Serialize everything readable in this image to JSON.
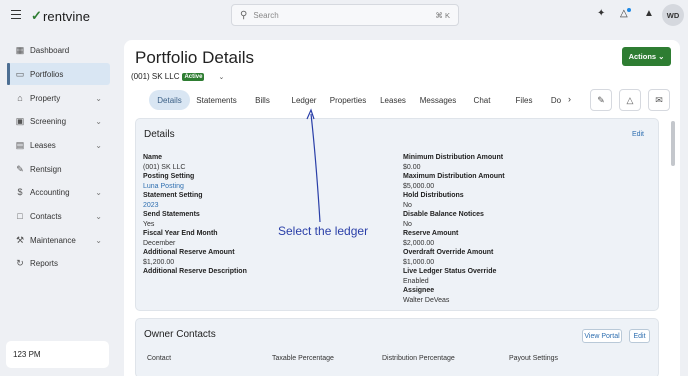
{
  "header": {
    "brand": "rentvine",
    "brand_mark": "✓",
    "search_placeholder": "Search",
    "search_shortcut": "⌘ K",
    "avatar_initials": "WD"
  },
  "sidebar": {
    "items": [
      {
        "label": "Dashboard",
        "icon": "dashboard-icon",
        "glyph": "▦"
      },
      {
        "label": "Portfolios",
        "icon": "folder-icon",
        "glyph": "▭"
      },
      {
        "label": "Property",
        "icon": "building-icon",
        "glyph": "⌂"
      },
      {
        "label": "Screening",
        "icon": "screening-icon",
        "glyph": "▣"
      },
      {
        "label": "Leases",
        "icon": "document-icon",
        "glyph": "▤"
      },
      {
        "label": "Rentsign",
        "icon": "signature-icon",
        "glyph": "✎"
      },
      {
        "label": "Accounting",
        "icon": "dollar-icon",
        "glyph": "$"
      },
      {
        "label": "Contacts",
        "icon": "contacts-icon",
        "glyph": "□"
      },
      {
        "label": "Maintenance",
        "icon": "wrench-icon",
        "glyph": "⚒"
      },
      {
        "label": "Reports",
        "icon": "reports-icon",
        "glyph": "↻"
      }
    ],
    "clock": "123 PM"
  },
  "page": {
    "title": "Portfolio Details",
    "portfolio_name": "(001) SK LLC",
    "status_badge": "Active",
    "actions_label": "Actions ⌄",
    "tabs": [
      "Details",
      "Statements",
      "Bills",
      "Ledger",
      "Properties",
      "Leases",
      "Messages",
      "Chat",
      "Files",
      "Do"
    ]
  },
  "details": {
    "title": "Details",
    "edit": "Edit",
    "left": [
      {
        "label": "Name",
        "value": "(001) SK LLC"
      },
      {
        "label": "Posting Setting",
        "value": "Luna Posting"
      },
      {
        "label": "Statement Setting",
        "value": "2023"
      },
      {
        "label": "Send Statements",
        "value": "Yes"
      },
      {
        "label": "Fiscal Year End Month",
        "value": "December"
      },
      {
        "label": "Additional Reserve Amount",
        "value": "$1,200.00"
      },
      {
        "label": "Additional Reserve Description",
        "value": ""
      }
    ],
    "right": [
      {
        "label": "Minimum Distribution Amount",
        "value": "$0.00"
      },
      {
        "label": "Maximum Distribution Amount",
        "value": "$5,000.00"
      },
      {
        "label": "Hold Distributions",
        "value": "No"
      },
      {
        "label": "Disable Balance Notices",
        "value": "No"
      },
      {
        "label": "Reserve Amount",
        "value": "$2,000.00"
      },
      {
        "label": "Overdraft Override Amount",
        "value": "$1,000.00"
      },
      {
        "label": "Live Ledger Status Override",
        "value": "Enabled"
      },
      {
        "label": "Assignee",
        "value": "Walter DeVeas"
      }
    ]
  },
  "owner_contacts": {
    "title": "Owner Contacts",
    "view_portal": "View Portal",
    "edit": "Edit",
    "columns": [
      "Contact",
      "Taxable Percentage",
      "Distribution Percentage",
      "Payout Settings"
    ]
  },
  "annotation": {
    "text": "Select the ledger",
    "color": "#2a3fa8"
  },
  "colors": {
    "accent_green": "#2e7d32",
    "active_tab_bg": "#d9e6f3",
    "link": "#2f6fb0"
  }
}
